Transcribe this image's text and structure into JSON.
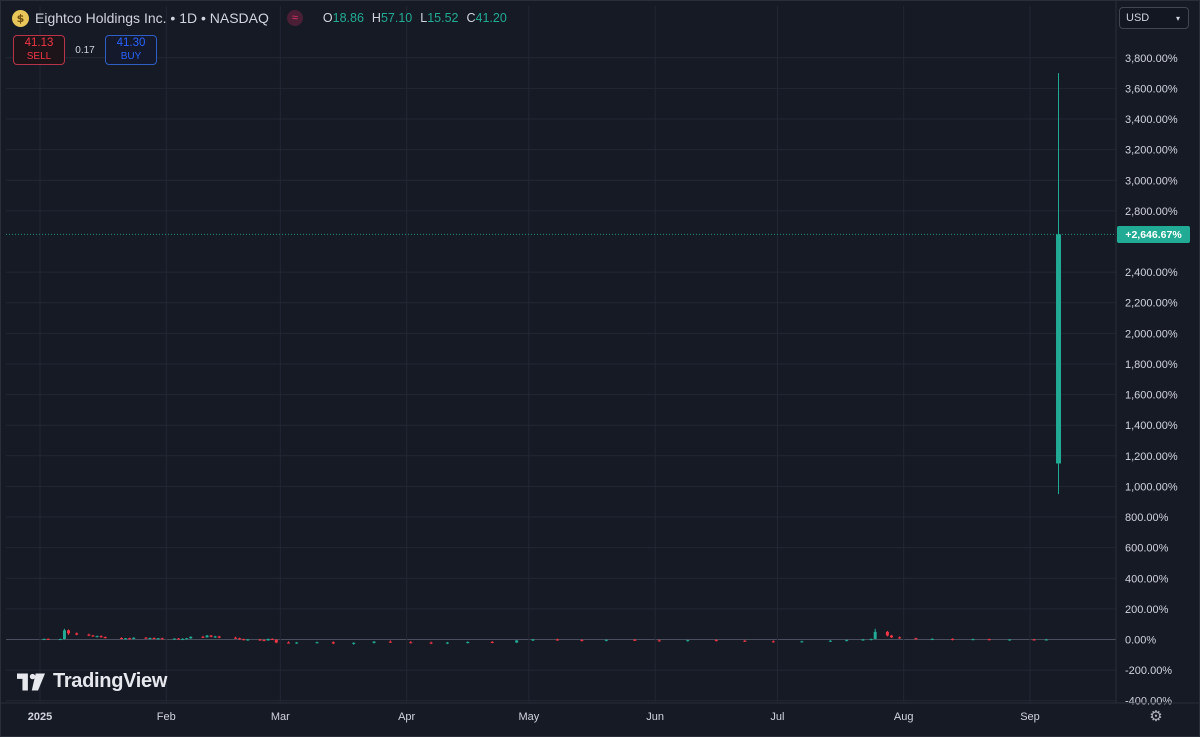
{
  "header": {
    "logo_glyph": "$",
    "title": "Eightco Holdings Inc. • 1D • NASDAQ",
    "flag_glyph": "≈",
    "ohlc": [
      {
        "key": "O",
        "value": "18.86"
      },
      {
        "key": "H",
        "value": "57.10"
      },
      {
        "key": "L",
        "value": "15.52"
      },
      {
        "key": "C",
        "value": "41.20"
      }
    ]
  },
  "trade": {
    "sell_price": "41.13",
    "sell_label": "SELL",
    "spread": "0.17",
    "buy_price": "41.30",
    "buy_label": "BUY"
  },
  "currency": {
    "label": "USD",
    "chevron": "▾"
  },
  "last_value_label": "+2,646.67%",
  "watermark": "TradingView",
  "settings_icon": "⚙",
  "colors": {
    "background": "#161a25",
    "grid": "#232734",
    "up": "#22ab94",
    "down": "#f23645",
    "text": "#d1d4dc"
  },
  "chart_data": {
    "type": "candlestick",
    "title": "Eightco Holdings Inc. • 1D • NASDAQ",
    "ylabel": "",
    "y_unit": "percent",
    "y_scale": "percentage",
    "ylim": [
      -400,
      4000
    ],
    "y_ticks": [
      "3,800.00%",
      "3,600.00%",
      "3,400.00%",
      "3,200.00%",
      "3,000.00%",
      "2,800.00%",
      "2,400.00%",
      "2,200.00%",
      "2,000.00%",
      "1,800.00%",
      "1,600.00%",
      "1,400.00%",
      "1,200.00%",
      "1,000.00%",
      "800.00%",
      "600.00%",
      "400.00%",
      "200.00%",
      "0.00%",
      "-200.00%",
      "-400.00%"
    ],
    "y_tick_values": [
      3800,
      3600,
      3400,
      3200,
      3000,
      2800,
      2400,
      2200,
      2000,
      1800,
      1600,
      1400,
      1200,
      1000,
      800,
      600,
      400,
      200,
      0,
      -200,
      -400
    ],
    "x_ticks": [
      "2025",
      "Feb",
      "Mar",
      "Apr",
      "May",
      "Jun",
      "Jul",
      "Aug",
      "Sep"
    ],
    "x_tick_dates": [
      "2025-01-01",
      "2025-02-01",
      "2025-03-01",
      "2025-04-01",
      "2025-05-01",
      "2025-06-01",
      "2025-07-01",
      "2025-08-01",
      "2025-09-01"
    ],
    "last_value": 2646.67,
    "grid": true,
    "legend": "none",
    "candles": [
      {
        "date": "2025-01-02",
        "open": 0,
        "high": 6,
        "low": -4,
        "close": 4
      },
      {
        "date": "2025-01-03",
        "open": 4,
        "high": 8,
        "low": 0,
        "close": 2
      },
      {
        "date": "2025-01-06",
        "open": 2,
        "high": 6,
        "low": -2,
        "close": 3
      },
      {
        "date": "2025-01-07",
        "open": 3,
        "high": 70,
        "low": 0,
        "close": 60
      },
      {
        "date": "2025-01-08",
        "open": 60,
        "high": 66,
        "low": 30,
        "close": 40
      },
      {
        "date": "2025-01-10",
        "open": 40,
        "high": 46,
        "low": 28,
        "close": 32
      },
      {
        "date": "2025-01-13",
        "open": 32,
        "high": 38,
        "low": 22,
        "close": 26
      },
      {
        "date": "2025-01-14",
        "open": 26,
        "high": 30,
        "low": 18,
        "close": 20
      },
      {
        "date": "2025-01-15",
        "open": 20,
        "high": 26,
        "low": 14,
        "close": 22
      },
      {
        "date": "2025-01-16",
        "open": 22,
        "high": 28,
        "low": 12,
        "close": 16
      },
      {
        "date": "2025-01-17",
        "open": 16,
        "high": 20,
        "low": 6,
        "close": 10
      },
      {
        "date": "2025-01-21",
        "open": 10,
        "high": 14,
        "low": 2,
        "close": 6
      },
      {
        "date": "2025-01-22",
        "open": 6,
        "high": 10,
        "low": 0,
        "close": 8
      },
      {
        "date": "2025-01-23",
        "open": 8,
        "high": 12,
        "low": 0,
        "close": 4
      },
      {
        "date": "2025-01-24",
        "open": 4,
        "high": 14,
        "low": 2,
        "close": 12
      },
      {
        "date": "2025-01-27",
        "open": 12,
        "high": 16,
        "low": 4,
        "close": 6
      },
      {
        "date": "2025-01-28",
        "open": 6,
        "high": 12,
        "low": 2,
        "close": 10
      },
      {
        "date": "2025-01-29",
        "open": 10,
        "high": 14,
        "low": 2,
        "close": 4
      },
      {
        "date": "2025-01-30",
        "open": 4,
        "high": 10,
        "low": 0,
        "close": 8
      },
      {
        "date": "2025-01-31",
        "open": 8,
        "high": 12,
        "low": 0,
        "close": 2
      },
      {
        "date": "2025-02-03",
        "open": 2,
        "high": 8,
        "low": -2,
        "close": 6
      },
      {
        "date": "2025-02-04",
        "open": 6,
        "high": 10,
        "low": 0,
        "close": 2
      },
      {
        "date": "2025-02-05",
        "open": 2,
        "high": 8,
        "low": -4,
        "close": 4
      },
      {
        "date": "2025-02-06",
        "open": 4,
        "high": 10,
        "low": 0,
        "close": 8
      },
      {
        "date": "2025-02-07",
        "open": 8,
        "high": 20,
        "low": 4,
        "close": 18
      },
      {
        "date": "2025-02-10",
        "open": 18,
        "high": 24,
        "low": 10,
        "close": 14
      },
      {
        "date": "2025-02-11",
        "open": 14,
        "high": 30,
        "low": 12,
        "close": 26
      },
      {
        "date": "2025-02-12",
        "open": 26,
        "high": 30,
        "low": 14,
        "close": 18
      },
      {
        "date": "2025-02-13",
        "open": 18,
        "high": 24,
        "low": 10,
        "close": 20
      },
      {
        "date": "2025-02-14",
        "open": 20,
        "high": 24,
        "low": 8,
        "close": 12
      },
      {
        "date": "2025-02-18",
        "open": 12,
        "high": 18,
        "low": 4,
        "close": 8
      },
      {
        "date": "2025-02-19",
        "open": 8,
        "high": 12,
        "low": -2,
        "close": 2
      },
      {
        "date": "2025-02-20",
        "open": 2,
        "high": 6,
        "low": -6,
        "close": -2
      },
      {
        "date": "2025-02-21",
        "open": -2,
        "high": 4,
        "low": -8,
        "close": 0
      },
      {
        "date": "2025-02-24",
        "open": 0,
        "high": 4,
        "low": -8,
        "close": -4
      },
      {
        "date": "2025-02-25",
        "open": -4,
        "high": 2,
        "low": -10,
        "close": -6
      },
      {
        "date": "2025-02-26",
        "open": -6,
        "high": 6,
        "low": -8,
        "close": 4
      },
      {
        "date": "2025-02-27",
        "open": 4,
        "high": 8,
        "low": -4,
        "close": -2
      },
      {
        "date": "2025-02-28",
        "open": -2,
        "high": 2,
        "low": -24,
        "close": -20
      },
      {
        "date": "2025-03-03",
        "open": -20,
        "high": -12,
        "low": -26,
        "close": -22
      },
      {
        "date": "2025-03-05",
        "open": -22,
        "high": -16,
        "low": -28,
        "close": -20
      },
      {
        "date": "2025-03-10",
        "open": -20,
        "high": -14,
        "low": -26,
        "close": -18
      },
      {
        "date": "2025-03-14",
        "open": -18,
        "high": -12,
        "low": -30,
        "close": -26
      },
      {
        "date": "2025-03-19",
        "open": -26,
        "high": -18,
        "low": -34,
        "close": -22
      },
      {
        "date": "2025-03-24",
        "open": -22,
        "high": -10,
        "low": -26,
        "close": -14
      },
      {
        "date": "2025-03-28",
        "open": -14,
        "high": -6,
        "low": -22,
        "close": -18
      },
      {
        "date": "2025-04-02",
        "open": -18,
        "high": -10,
        "low": -24,
        "close": -20
      },
      {
        "date": "2025-04-07",
        "open": -20,
        "high": -14,
        "low": -30,
        "close": -26
      },
      {
        "date": "2025-04-11",
        "open": -26,
        "high": -16,
        "low": -30,
        "close": -20
      },
      {
        "date": "2025-04-16",
        "open": -20,
        "high": -12,
        "low": -26,
        "close": -16
      },
      {
        "date": "2025-04-22",
        "open": -16,
        "high": -10,
        "low": -24,
        "close": -20
      },
      {
        "date": "2025-04-28",
        "open": -20,
        "high": -4,
        "low": -22,
        "close": -6
      },
      {
        "date": "2025-05-02",
        "open": -6,
        "high": 4,
        "low": -10,
        "close": 0
      },
      {
        "date": "2025-05-08",
        "open": 0,
        "high": 6,
        "low": -8,
        "close": -4
      },
      {
        "date": "2025-05-14",
        "open": -4,
        "high": 2,
        "low": -12,
        "close": -8
      },
      {
        "date": "2025-05-20",
        "open": -8,
        "high": 0,
        "low": -12,
        "close": -2
      },
      {
        "date": "2025-05-27",
        "open": -2,
        "high": 4,
        "low": -10,
        "close": -6
      },
      {
        "date": "2025-06-02",
        "open": -6,
        "high": 0,
        "low": -14,
        "close": -10
      },
      {
        "date": "2025-06-09",
        "open": -10,
        "high": -2,
        "low": -14,
        "close": -4
      },
      {
        "date": "2025-06-16",
        "open": -4,
        "high": 2,
        "low": -12,
        "close": -8
      },
      {
        "date": "2025-06-23",
        "open": -8,
        "high": -2,
        "low": -16,
        "close": -12
      },
      {
        "date": "2025-06-30",
        "open": -12,
        "high": -6,
        "low": -20,
        "close": -16
      },
      {
        "date": "2025-07-07",
        "open": -16,
        "high": -8,
        "low": -20,
        "close": -12
      },
      {
        "date": "2025-07-14",
        "open": -12,
        "high": -4,
        "low": -16,
        "close": -8
      },
      {
        "date": "2025-07-18",
        "open": -8,
        "high": 0,
        "low": -12,
        "close": -4
      },
      {
        "date": "2025-07-22",
        "open": -4,
        "high": 4,
        "low": -8,
        "close": 0
      },
      {
        "date": "2025-07-24",
        "open": 0,
        "high": 6,
        "low": -6,
        "close": 4
      },
      {
        "date": "2025-07-25",
        "open": 4,
        "high": 70,
        "low": 2,
        "close": 50
      },
      {
        "date": "2025-07-28",
        "open": 50,
        "high": 56,
        "low": 20,
        "close": 26
      },
      {
        "date": "2025-07-29",
        "open": 26,
        "high": 30,
        "low": 10,
        "close": 14
      },
      {
        "date": "2025-07-31",
        "open": 14,
        "high": 20,
        "low": 4,
        "close": 8
      },
      {
        "date": "2025-08-04",
        "open": 8,
        "high": 12,
        "low": -2,
        "close": 2
      },
      {
        "date": "2025-08-08",
        "open": 2,
        "high": 8,
        "low": -4,
        "close": 4
      },
      {
        "date": "2025-08-13",
        "open": 4,
        "high": 8,
        "low": -6,
        "close": -2
      },
      {
        "date": "2025-08-18",
        "open": -2,
        "high": 6,
        "low": -4,
        "close": 2
      },
      {
        "date": "2025-08-22",
        "open": 2,
        "high": 6,
        "low": -6,
        "close": -4
      },
      {
        "date": "2025-08-27",
        "open": -4,
        "high": 2,
        "low": -8,
        "close": 0
      },
      {
        "date": "2025-09-02",
        "open": 0,
        "high": 4,
        "low": -6,
        "close": -2
      },
      {
        "date": "2025-09-05",
        "open": -2,
        "high": 4,
        "low": -6,
        "close": 0
      },
      {
        "date": "2025-09-08",
        "open": 1150,
        "high": 3700,
        "low": 950,
        "close": 2646.67
      }
    ]
  }
}
